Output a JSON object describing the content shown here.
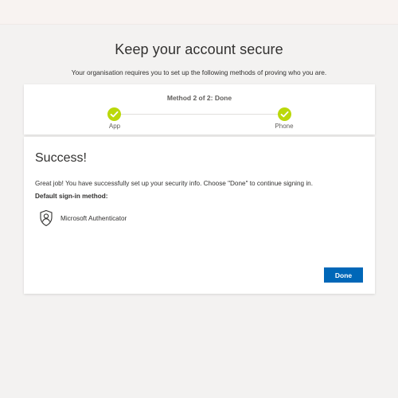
{
  "header": {
    "title": "Keep your account secure",
    "subtitle": "Your organisation requires you to set up the following methods of proving who you are."
  },
  "progress": {
    "status": "Method 2 of 2: Done",
    "steps": [
      {
        "label": "App",
        "state": "complete"
      },
      {
        "label": "Phone",
        "state": "complete"
      }
    ],
    "check_color": "#bad80a"
  },
  "main": {
    "heading": "Success!",
    "message": "Great job! You have successfully set up your security info. Choose \"Done\" to continue signing in.",
    "default_method_label": "Default sign-in method:",
    "default_method": {
      "icon": "authenticator-icon",
      "name": "Microsoft Authenticator"
    },
    "done_label": "Done"
  },
  "colors": {
    "accent": "#0067b8",
    "background": "#f3f2f1"
  }
}
